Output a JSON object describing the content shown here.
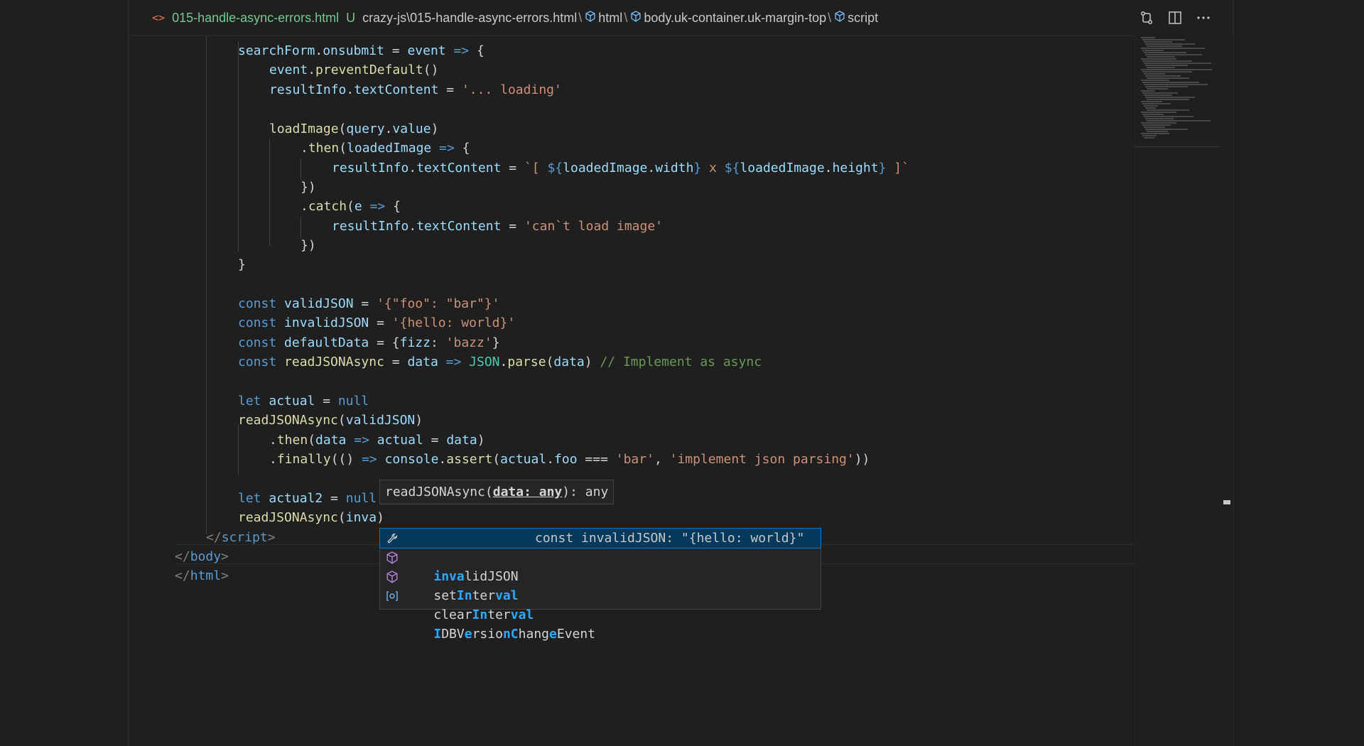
{
  "breadcrumb": {
    "file_name": "015-handle-async-errors.html",
    "status": "U",
    "path": "crazy-js\\015-handle-async-errors.html",
    "sep": "\\",
    "seg_html": "html",
    "seg_body": "body.uk-container.uk-margin-top",
    "seg_script": "script"
  },
  "code": {
    "l1_obj": "searchForm",
    "l1_prop": "onsubmit",
    "l1_arg": "event",
    "l2_obj": "event",
    "l2_fn": "preventDefault",
    "l3_obj": "resultInfo",
    "l3_prop": "textContent",
    "l3_str": "'... loading'",
    "l5_fn": "loadImage",
    "l5_arg": "query",
    "l5_prop": "value",
    "l6_fn": "then",
    "l6_arg": "loadedImage",
    "l7_obj": "resultInfo",
    "l7_prop": "textContent",
    "l7_tpl1": "`[ ",
    "l7_v1": "loadedImage",
    "l7_p1": "width",
    "l7_mid": " x ",
    "l7_v2": "loadedImage",
    "l7_p2": "height",
    "l7_tpl2": " ]`",
    "l9_fn": "catch",
    "l9_arg": "e",
    "l10_obj": "resultInfo",
    "l10_prop": "textContent",
    "l10_str": "'can`t load image'",
    "l14_name": "validJSON",
    "l14_str": "'{\"foo\": \"bar\"}'",
    "l15_name": "invalidJSON",
    "l15_str": "'{hello: world}'",
    "l16_name": "defaultData",
    "l16_key": "fizz",
    "l16_str": "'bazz'",
    "l17_name": "readJSONAsync",
    "l17_arg": "data",
    "l17_obj": "JSON",
    "l17_fn": "parse",
    "l17_arg2": "data",
    "l17_cmt": "// Implement as async",
    "l19_name": "actual",
    "l19_null": "null",
    "l20_fn": "readJSONAsync",
    "l20_arg": "validJSON",
    "l21_fn": "then",
    "l21_arg": "data",
    "l21_v": "actual",
    "l21_v2": "data",
    "l22_fn": "finally",
    "l22_obj": "console",
    "l22_fn2": "assert",
    "l22_v": "actual",
    "l22_p": "foo",
    "l22_s1": "'bar'",
    "l22_s2": "'implement json parsing'",
    "l24_name": "actual2",
    "l24_null": "null",
    "l25_fn": "readJSONAsync",
    "l25_typed": "inva",
    "l26_tag": "script",
    "l27_tag": "body",
    "l28_tag": "html",
    "kw_const": "const",
    "kw_let": "let"
  },
  "signature_hint": {
    "fn": "readJSONAsync",
    "param": "data: any",
    "ret": "any"
  },
  "suggestions": [
    {
      "icon": "wrench-icon",
      "pre": "",
      "hl1": "inva",
      "mid": "",
      "hl2": "",
      "rest": "lidJSON",
      "detail": "const invalidJSON: \"{hello: world}\""
    },
    {
      "icon": "cube-icon",
      "pre": "set",
      "hl1": "In",
      "mid": "ter",
      "hl2": "val",
      "rest": "",
      "detail": ""
    },
    {
      "icon": "cube-icon",
      "pre": "clear",
      "hl1": "In",
      "mid": "ter",
      "hl2": "val",
      "rest": "",
      "detail": ""
    },
    {
      "icon": "class-icon",
      "label": "IDBVersionChangeEvent",
      "detail": ""
    }
  ],
  "colors": {
    "background": "#1e1e1e",
    "keyword": "#569cd6",
    "variable": "#9cdcfe",
    "function": "#dcdcaa",
    "string": "#ce9178",
    "comment": "#6a9955",
    "highlight": "#2aaaff",
    "untracked": "#73c991"
  }
}
